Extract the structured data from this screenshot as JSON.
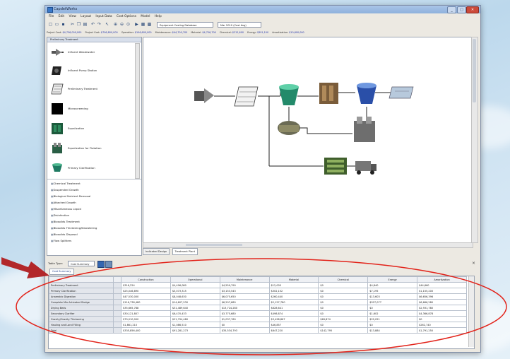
{
  "window": {
    "title": "CapdetWorks",
    "controls": [
      "minimize-icon",
      "maximize-icon",
      "close-icon"
    ]
  },
  "menu": [
    "File",
    "Edit",
    "View",
    "Layout",
    "Input Data",
    "Cost Options",
    "Model",
    "Help"
  ],
  "toolbar": {
    "icons": [
      "new-icon",
      "open-icon",
      "save-icon",
      "cut-icon",
      "copy-icon",
      "paste-icon",
      "undo-icon",
      "redo-icon",
      "pointer-icon",
      "zoom-in-icon",
      "zoom-out-icon",
      "zoom-fit-icon",
      "run-icon",
      "chart-icon",
      "table-icon"
    ],
    "combo1_value": "Equipment Costing Database",
    "combo2_value": "Mar 2010 (Cost Avg)"
  },
  "costbar": [
    {
      "label": "Project Cost:",
      "value": "$4,756,000,000"
    },
    {
      "label": "Project Cost:",
      "value": "$706,800,000"
    },
    {
      "label": "Operation:",
      "value": "$106,600,000"
    },
    {
      "label": "Maintenance:",
      "value": "$44,700,700"
    },
    {
      "label": "Material:",
      "value": "$4,756,700"
    },
    {
      "label": "Chemical:",
      "value": "$212,600"
    },
    {
      "label": "Energy:",
      "value": "$391,100"
    },
    {
      "label": "Amortization:",
      "value": "$10,600,000"
    }
  ],
  "palette": {
    "header": "Preliminary Treatment",
    "items": [
      {
        "label": "Influent Wastewater",
        "icon": "influent-pump-icon"
      },
      {
        "label": "Influent Pump Station",
        "icon": "pump-station-icon"
      },
      {
        "label": "Preliminary Treatment",
        "icon": "screen-icon"
      },
      {
        "label": "Microscreening",
        "icon": "microscreen-icon"
      },
      {
        "label": "Equalization",
        "icon": "equalization-icon"
      },
      {
        "label": "Equalization for Flotation",
        "icon": "flotation-icon"
      },
      {
        "label": "Primary Clarification",
        "icon": "clarifier-icon"
      }
    ],
    "categories": [
      "Chemical Treatment",
      "Suspended Growth",
      "Biological Nutrient Removal",
      "Attached Growth",
      "Miscellaneous Liquid",
      "Disinfection",
      "Biosolids Treatment",
      "Biosolids Thickening/Dewatering",
      "Biosolids Disposal",
      "Flow Splitters"
    ]
  },
  "view_tabs": [
    "Indicated Design",
    "Treatment Plant"
  ],
  "bottom": {
    "table_type_label": "Table Type:",
    "table_type_value": "Cost Summary",
    "tab_label": "Cost Summary",
    "columns": [
      "",
      "Construction",
      "Operational",
      "Maintenance",
      "Material",
      "Chemical",
      "Energy",
      "Amortization"
    ],
    "rows": [
      [
        "Preliminary Treatment",
        "$316,224",
        "$4,496,080",
        "$4,559,790",
        "$12,005",
        "$0",
        "$4,840",
        "$44,660"
      ],
      [
        "Primary Clarification",
        "$25,046,890",
        "$5,073,315",
        "$3,153,543",
        "$302,152",
        "$0",
        "$7,195",
        "$1,155,200"
      ],
      [
        "Anaerobic Digestion",
        "$47,530,000",
        "$8,048,630",
        "$6,075,650",
        "$260,440",
        "$0",
        "$13,603",
        "$6,656,396"
      ],
      [
        "Complete Mix Activated Sludge",
        "$116,738,480",
        "$14,607,530",
        "$6,207,680",
        "$2,157,780",
        "$0",
        "$527,077",
        "$6,666,280"
      ],
      [
        "Drying Beds",
        "$35,665,788",
        "$31,489,640",
        "$13,724,280",
        "$628,641",
        "$0",
        "$0",
        "$2,931,780"
      ],
      [
        "Secondary Clarifier",
        "$30,121,807",
        "$6,470,433",
        "$3,775,680",
        "$498,874",
        "$0",
        "$1,602",
        "$4,366,878"
      ],
      [
        "Gravity/Gravity Thickening",
        "$79,010,000",
        "$21,794,480",
        "$1,037,760",
        "$3,498,867",
        "$69,874",
        "$29,021",
        "$0"
      ],
      [
        "Hauling and Land Filling",
        "$1,861,210",
        "$1,086,510",
        "$0",
        "$46,857",
        "$0",
        "$0",
        "$262,740"
      ],
      [
        "Total",
        "$335,856,400",
        "$91,281,273",
        "$35,534,793",
        "$647,220",
        "$142,795",
        "$13,884",
        "$1,791,250"
      ]
    ]
  },
  "annotations": {
    "arrow_color": "#b2272a",
    "ellipse_color": "#e2231a"
  }
}
